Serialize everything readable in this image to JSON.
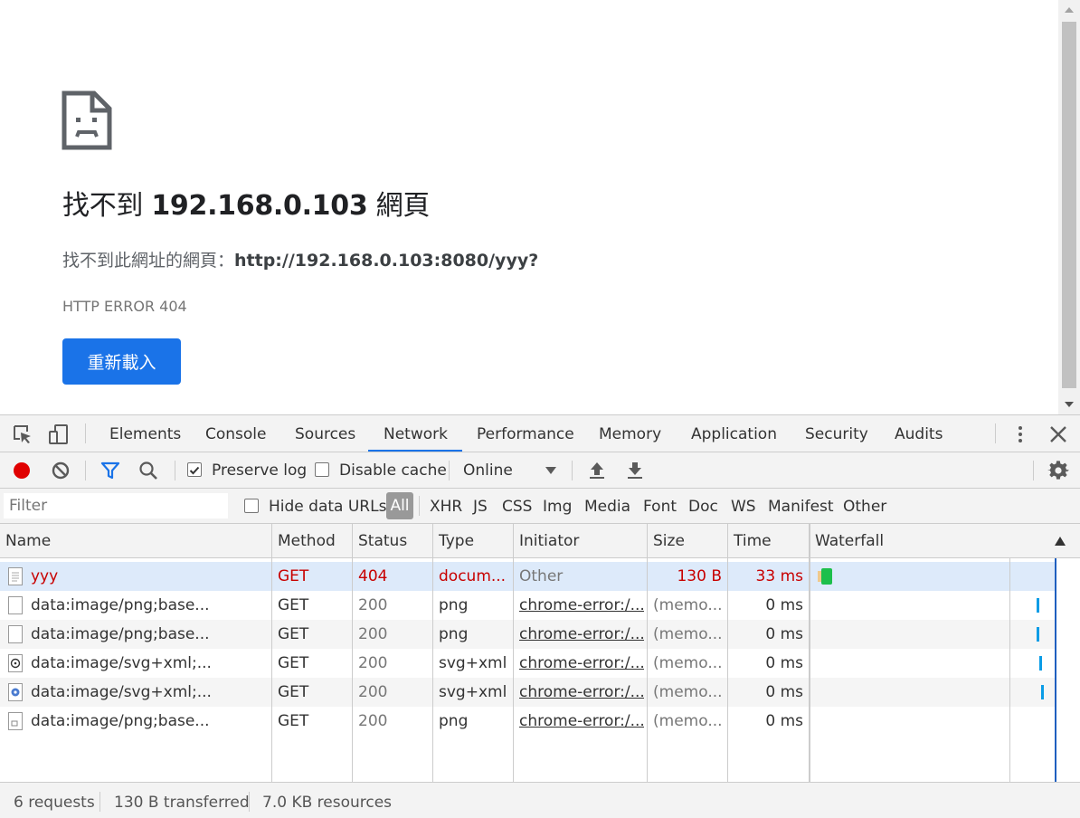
{
  "error_page": {
    "title_prefix": "找不到",
    "title_host": "192.168.0.103",
    "title_suffix": "網頁",
    "desc_prefix": "找不到此網址的網頁：",
    "desc_url": "http://192.168.0.103:8080/yyy?",
    "error_code": "HTTP ERROR 404",
    "reload_label": "重新載入",
    "button_color": "#1a73e8"
  },
  "devtools": {
    "tabs": [
      "Elements",
      "Console",
      "Sources",
      "Network",
      "Performance",
      "Memory",
      "Application",
      "Security",
      "Audits"
    ],
    "active_tab": "Network",
    "toolbar": {
      "preserve_log": "Preserve log",
      "preserve_log_checked": true,
      "disable_cache": "Disable cache",
      "disable_cache_checked": false,
      "throttling": "Online"
    },
    "filter": {
      "placeholder": "Filter",
      "hide_data_urls": "Hide data URLs",
      "types": [
        "All",
        "XHR",
        "JS",
        "CSS",
        "Img",
        "Media",
        "Font",
        "Doc",
        "WS",
        "Manifest",
        "Other"
      ],
      "active_type": "All"
    },
    "columns": [
      "Name",
      "Method",
      "Status",
      "Type",
      "Initiator",
      "Size",
      "Time",
      "Waterfall"
    ],
    "rows": [
      {
        "name": "yyy",
        "method": "GET",
        "status": "404",
        "type": "docum...",
        "initiator": "Other",
        "size": "130 B",
        "time": "33 ms",
        "error": true
      },
      {
        "name": "data:image/png;base...",
        "method": "GET",
        "status": "200",
        "type": "png",
        "initiator": "chrome-error:/...",
        "size": "(memo...",
        "time": "0 ms",
        "error": false
      },
      {
        "name": "data:image/png;base...",
        "method": "GET",
        "status": "200",
        "type": "png",
        "initiator": "chrome-error:/...",
        "size": "(memo...",
        "time": "0 ms",
        "error": false
      },
      {
        "name": "data:image/svg+xml;...",
        "method": "GET",
        "status": "200",
        "type": "svg+xml",
        "initiator": "chrome-error:/...",
        "size": "(memo...",
        "time": "0 ms",
        "error": false
      },
      {
        "name": "data:image/svg+xml;...",
        "method": "GET",
        "status": "200",
        "type": "svg+xml",
        "initiator": "chrome-error:/...",
        "size": "(memo...",
        "time": "0 ms",
        "error": false
      },
      {
        "name": "data:image/png;base...",
        "method": "GET",
        "status": "200",
        "type": "png",
        "initiator": "chrome-error:/...",
        "size": "(memo...",
        "time": "0 ms",
        "error": false
      }
    ],
    "status_bar": {
      "requests": "6 requests",
      "transferred": "130 B transferred",
      "resources": "7.0 KB resources"
    },
    "colors": {
      "record": "#e00000",
      "accent": "#1a73e8",
      "error_text": "#c80000",
      "waterfall_bar": "#0a9ce6",
      "waterfall_first": "#1dbf4b"
    }
  }
}
